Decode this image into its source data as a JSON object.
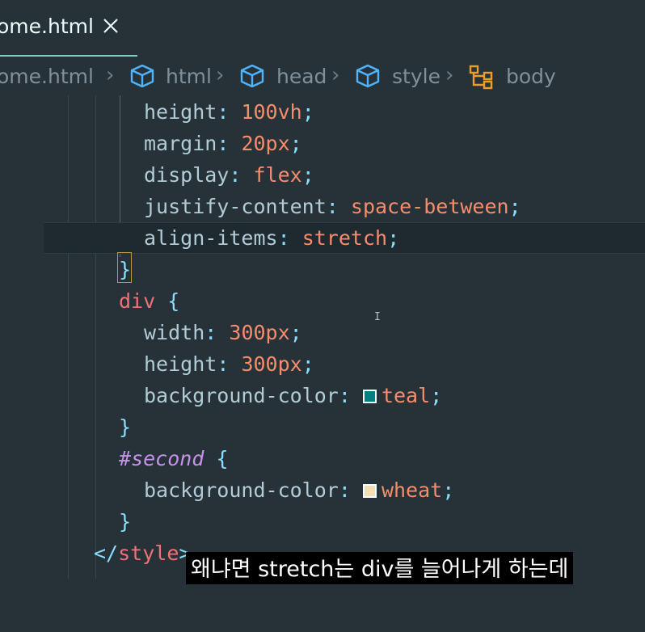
{
  "tab": {
    "title": "ome.html",
    "close_icon": "close-icon"
  },
  "breadcrumb": {
    "items": [
      {
        "label": "ome.html",
        "icon": ""
      },
      {
        "label": "html",
        "icon": "cube-icon"
      },
      {
        "label": "head",
        "icon": "cube-icon"
      },
      {
        "label": "style",
        "icon": "cube-icon"
      },
      {
        "label": "body",
        "icon": "symbol-structure-icon"
      }
    ],
    "separator": "›"
  },
  "code": {
    "l1": {
      "prop": "height",
      "colon": ":",
      "num": "100",
      "unit": "vh",
      "semi": ";"
    },
    "l2": {
      "prop": "margin",
      "colon": ":",
      "num": "20",
      "unit": "px",
      "semi": ";"
    },
    "l3": {
      "prop": "display",
      "colon": ":",
      "val": "flex",
      "semi": ";"
    },
    "l4": {
      "prop": "justify-content",
      "colon": ":",
      "val": "space-between",
      "semi": ";"
    },
    "l5": {
      "prop": "align-items",
      "colon": ":",
      "val": "stretch",
      "semi": ";"
    },
    "l6": {
      "brace": "}"
    },
    "l7": {
      "selector": "div",
      "brace": "{"
    },
    "l8": {
      "prop": "width",
      "colon": ":",
      "num": "300",
      "unit": "px",
      "semi": ";"
    },
    "l9": {
      "prop": "height",
      "colon": ":",
      "num": "300",
      "unit": "px",
      "semi": ";"
    },
    "l10": {
      "prop": "background-color",
      "colon": ":",
      "val": "teal",
      "semi": ";",
      "swatch": "#008080"
    },
    "l11": {
      "brace": "}"
    },
    "l12": {
      "hash": "#",
      "id": "second",
      "brace": "{"
    },
    "l13": {
      "prop": "background-color",
      "colon": ":",
      "val": "wheat",
      "semi": ";",
      "swatch": "#f5deb3"
    },
    "l14": {
      "brace": "}"
    },
    "l15": {
      "open": "</",
      "tag": "style",
      "close": ">"
    }
  },
  "subtitle": {
    "text": "왜냐면 stretch는 div를 늘어나게 하는데"
  },
  "colors": {
    "accent": "#80cbc4",
    "background": "#263238",
    "number": "#f78c6c",
    "property": "#b2ccd6",
    "selector": "#f07178",
    "id": "#c792ea"
  }
}
